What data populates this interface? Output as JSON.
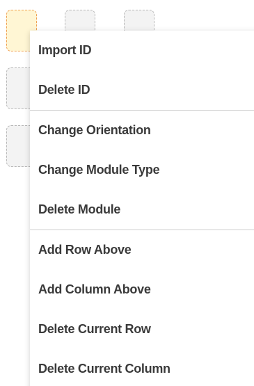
{
  "grid": {
    "cells": [
      {
        "state": "selected"
      },
      {
        "state": "empty"
      },
      {
        "state": "empty"
      },
      {
        "state": "empty"
      },
      {
        "state": "empty"
      }
    ]
  },
  "context_menu": {
    "groups": [
      [
        "Import ID",
        "Delete ID"
      ],
      [
        "Change Orientation",
        "Change Module Type",
        "Delete Module"
      ],
      [
        "Add Row Above",
        "Add Column Above",
        "Delete Current Row",
        "Delete Current Column"
      ]
    ]
  },
  "colors": {
    "selected_border": "#f0a050",
    "selected_fill": "#fff6d4",
    "cell_border": "#b8b8b8",
    "cell_fill": "#f3f3f3",
    "menu_text": "#3a3a3a",
    "separator": "#cfcfcf"
  }
}
